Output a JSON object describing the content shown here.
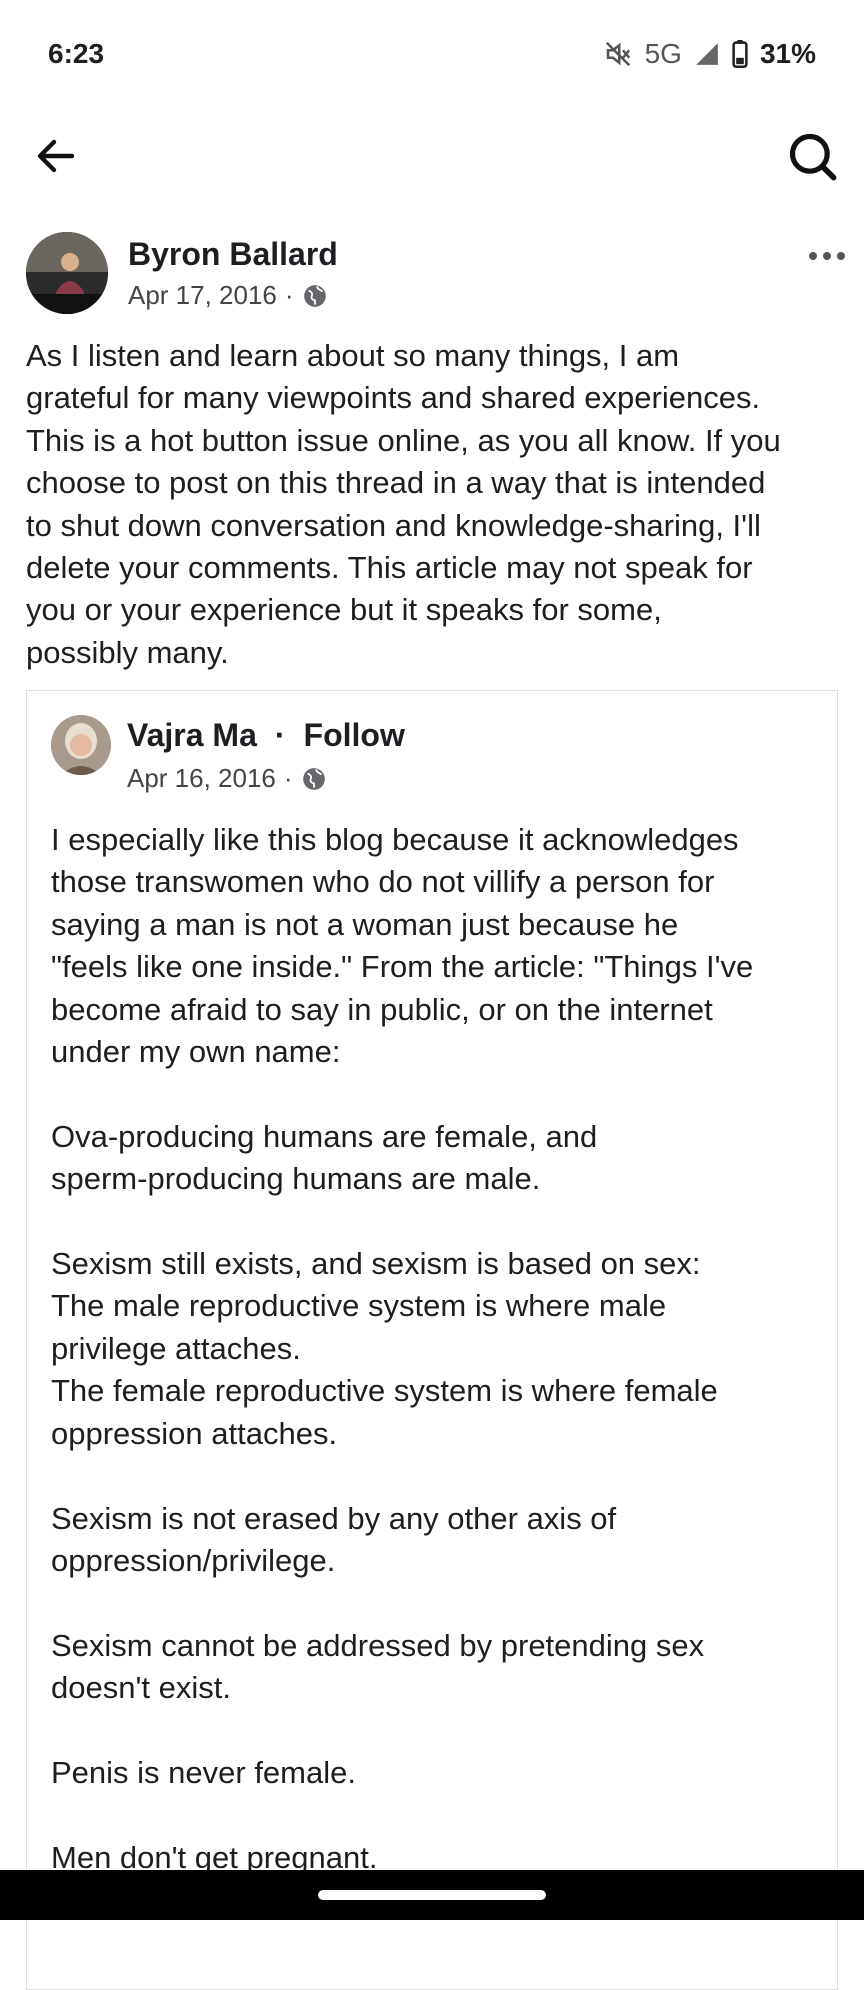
{
  "status_bar": {
    "time": "6:23",
    "network": "5G",
    "battery": "31%",
    "icons": [
      "mute-icon",
      "signal-icon",
      "battery-icon"
    ]
  },
  "toolbar": {
    "back_icon": "back-arrow-icon",
    "search_icon": "search-icon"
  },
  "post": {
    "author": "Byron Ballard",
    "date": "Apr 17, 2016",
    "separator": "·",
    "privacy_icon": "globe-icon",
    "more_icon": "more-options-icon",
    "text": "As I listen and learn about so many things, I am\ngrateful for many viewpoints and shared experiences.\nThis is a hot button issue online, as you all know. If you\nchoose to post on this thread in a way that is intended\nto shut down conversation and knowledge-sharing, I'll\ndelete your comments. This article may not speak for\nyou or your experience but it speaks for some,\npossibly many."
  },
  "shared_post": {
    "author": "Vajra Ma",
    "separator": "·",
    "follow_label": "Follow",
    "date": "Apr 16, 2016",
    "privacy_icon": "globe-icon",
    "text": "I especially like this blog because it acknowledges\nthose transwomen who do not villify a person for\nsaying a man is not a woman just because he\n\"feels like one inside.\" From the article: \"Things I've\nbecome afraid to say in public, or on the internet\nunder my own name:\n\nOva-producing humans are female, and\nsperm-producing humans are male.\n\nSexism still exists, and sexism is based on sex:\nThe male reproductive system is where male\nprivilege attaches.\nThe female reproductive system is where female\noppression attaches.\n\nSexism is not erased by any other axis of\noppression/privilege.\n\nSexism cannot be addressed by pretending sex\ndoesn't exist.\n\nPenis is never female.\n\nMen don't get pregnant."
  },
  "colors": {
    "text": "#1c1e21",
    "meta": "#444444",
    "border": "#dddfe2"
  }
}
